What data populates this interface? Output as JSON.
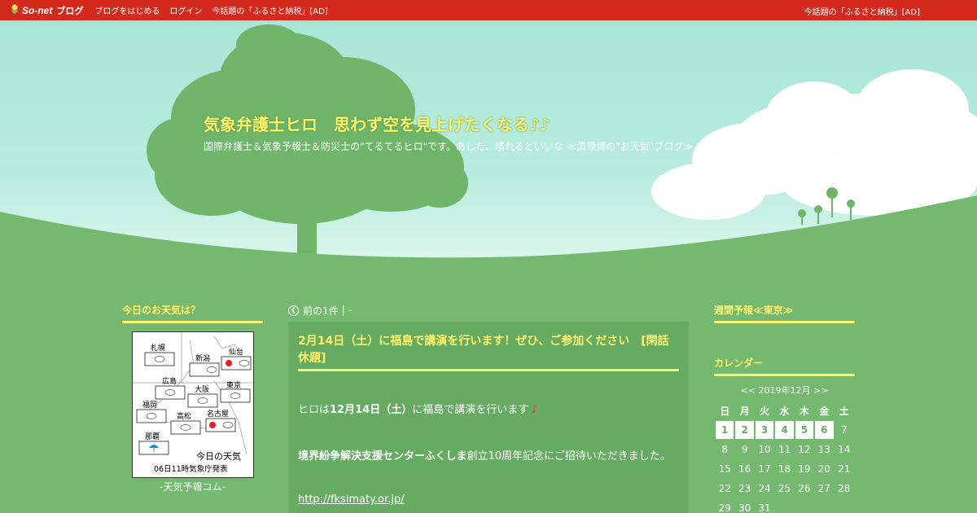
{
  "topbar": {
    "logo_text": "So-net",
    "logo_sub": "ブログ",
    "links": [
      "ブログをはじめる",
      "ログイン",
      "今話題の「ふるさと納税」[AD]"
    ],
    "right_ad": "今話題の「ふるさと納税」[AD]"
  },
  "header": {
    "title": "気象弁護士ヒロ　思わず空を見上げたくなる♪♪",
    "description": "国際弁護士＆気象予報士＆防災士の\"てるてるヒロ\"です。あした、晴れるといいな ≪清原博の\"お天気\"ブログ≫"
  },
  "left": {
    "weather_title": "今日のお天気は？",
    "map": {
      "cities": [
        "札幌",
        "仙台",
        "新潟",
        "広島",
        "大阪",
        "東京",
        "福岡",
        "高松",
        "名古屋",
        "那覇"
      ],
      "caption_line1": "今日の天気",
      "caption_line2": "06日11時気象庁発表"
    },
    "credit": "-天気予報コム-"
  },
  "center": {
    "pager_prev": "前の1件",
    "pager_sep": "| -",
    "article": {
      "title": "2月14日（土）に福島で講演を行います！ぜひ、ご参加ください　[閑話休題]",
      "p1_pre": "ヒロは",
      "p1_bold": "12月14日（土）",
      "p1_post": "に福島で講演を行います",
      "p2_bold": "境界紛争解決支援センターふくしま",
      "p2_post": "創立10周年記念にご招待いただきました。",
      "link": "http://fksimaty.or.jp/"
    }
  },
  "right": {
    "weekly_title": "週間予報≪東京≫",
    "calendar_title": "カレンダー",
    "calendar_nav": "<< 2019年12月 >>",
    "weekdays": [
      "日",
      "月",
      "火",
      "水",
      "木",
      "金",
      "土"
    ],
    "weeks": [
      [
        "1",
        "2",
        "3",
        "4",
        "5",
        "6",
        "7"
      ],
      [
        "8",
        "9",
        "10",
        "11",
        "12",
        "13",
        "14"
      ],
      [
        "15",
        "16",
        "17",
        "18",
        "19",
        "20",
        "21"
      ],
      [
        "22",
        "23",
        "24",
        "25",
        "26",
        "27",
        "28"
      ],
      [
        "29",
        "30",
        "31",
        "",
        "",
        "",
        ""
      ]
    ],
    "linked_days": [
      "1",
      "2",
      "3",
      "4",
      "5",
      "6"
    ]
  },
  "colors": {
    "topbar": "#d42a1e",
    "accent_yellow": "#fff36a",
    "background_green": "#74b96f"
  }
}
